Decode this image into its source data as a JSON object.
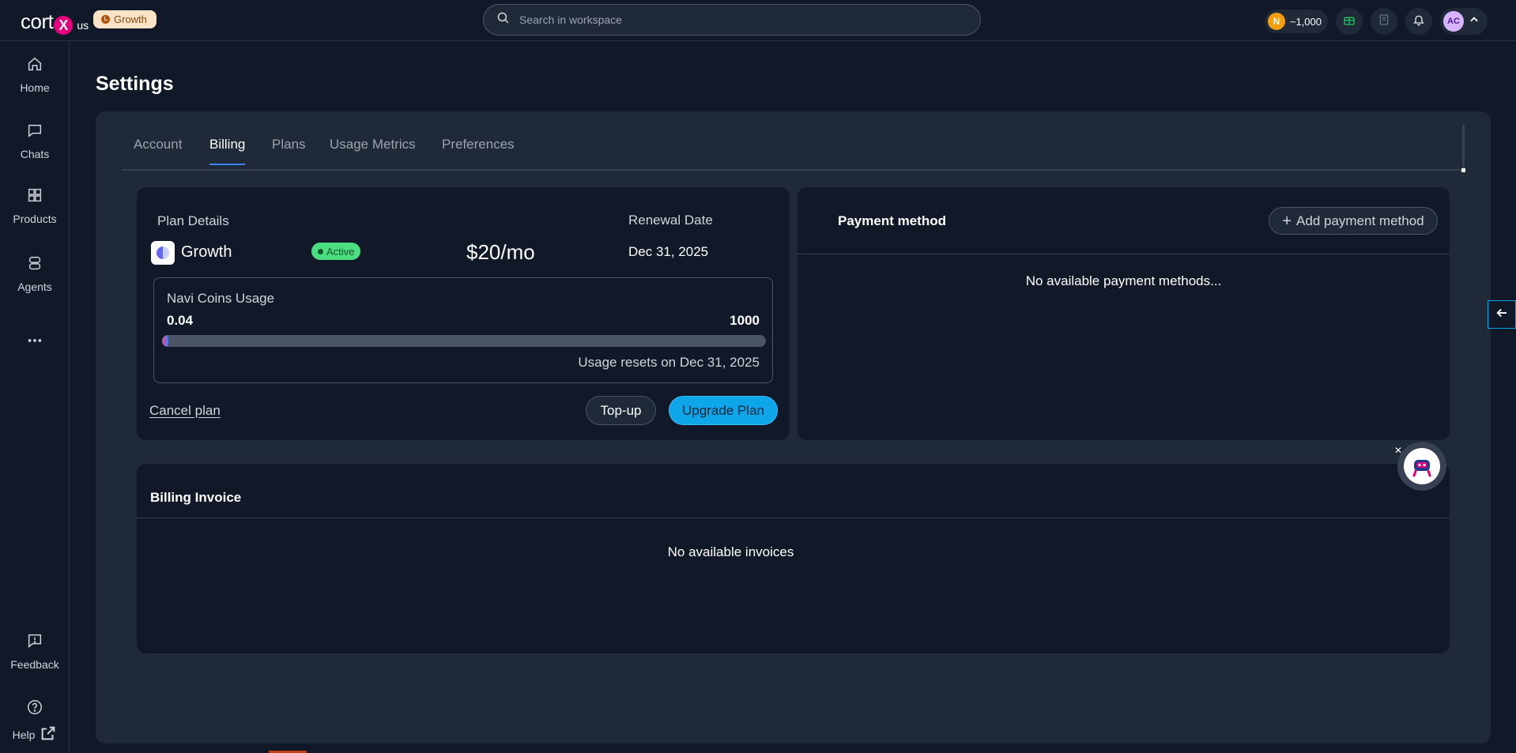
{
  "brand": {
    "logo_text": "cort",
    "logo_x": "X",
    "logo_suffix": "us",
    "plan_badge": "Growth"
  },
  "search": {
    "placeholder": "Search in workspace"
  },
  "topbar": {
    "coins": "~1,000",
    "avatar_initials": "AC"
  },
  "sidebar": {
    "items": [
      {
        "label": "Home",
        "icon": "home-icon"
      },
      {
        "label": "Chats",
        "icon": "chat-icon"
      },
      {
        "label": "Products",
        "icon": "products-icon"
      },
      {
        "label": "Agents",
        "icon": "agent-icon"
      }
    ],
    "bottom": [
      {
        "label": "Feedback",
        "icon": "feedback-icon"
      },
      {
        "label": "Help",
        "icon": "help-icon"
      }
    ]
  },
  "page": {
    "title": "Settings"
  },
  "tabs": [
    {
      "label": "Account",
      "active": false
    },
    {
      "label": "Billing",
      "active": true
    },
    {
      "label": "Plans",
      "active": false
    },
    {
      "label": "Usage Metrics",
      "active": false
    },
    {
      "label": "Preferences",
      "active": false
    }
  ],
  "plan": {
    "details_label": "Plan Details",
    "name": "Growth",
    "status": "Active",
    "price": "$20/mo",
    "renewal_label": "Renewal Date",
    "renewal_date": "Dec 31, 2025",
    "usage": {
      "title": "Navi Coins Usage",
      "used": "0.04",
      "limit": "1000",
      "fraction": 4e-05,
      "reset_text": "Usage resets on Dec 31, 2025"
    },
    "cancel_label": "Cancel plan",
    "topup_label": "Top-up",
    "upgrade_label": "Upgrade Plan"
  },
  "payment": {
    "title": "Payment method",
    "add_label": "Add payment method",
    "empty_text": "No available payment methods..."
  },
  "invoice": {
    "title": "Billing Invoice",
    "empty_text": "No available invoices"
  },
  "colors": {
    "accent": "#0ea5e9",
    "active_tab": "#3b82f6",
    "active_status": "#4ade80",
    "brand_pink": "#e6007e"
  }
}
